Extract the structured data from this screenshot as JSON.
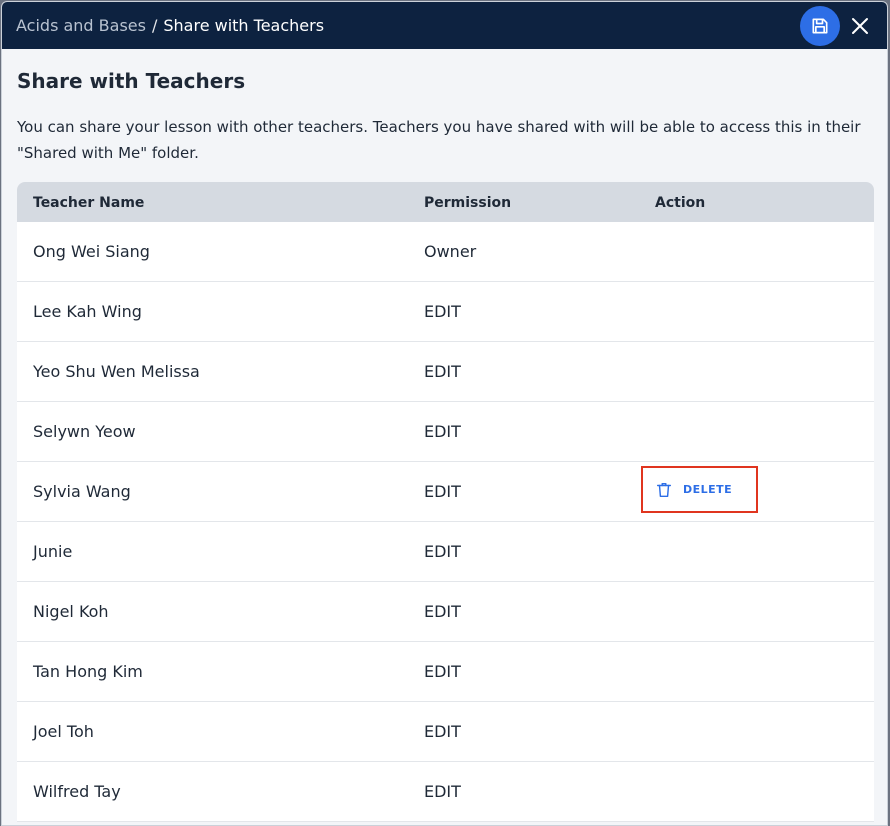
{
  "header": {
    "breadcrumb_parent": "Acids and Bases",
    "breadcrumb_separator": "/",
    "breadcrumb_current": "Share with Teachers",
    "save_icon": "save-icon",
    "close_icon": "close-icon"
  },
  "main": {
    "title": "Share with Teachers",
    "description": "You can share your lesson with other teachers. Teachers you have shared with will be able to access this in their \"Shared with Me\" folder."
  },
  "table": {
    "columns": [
      "Teacher Name",
      "Permission",
      "Action"
    ],
    "rows": [
      {
        "name": "Ong Wei Siang",
        "permission": "Owner"
      },
      {
        "name": "Lee Kah Wing",
        "permission": "EDIT"
      },
      {
        "name": "Yeo Shu Wen Melissa",
        "permission": "EDIT"
      },
      {
        "name": "Selywn Yeow",
        "permission": "EDIT"
      },
      {
        "name": "Sylvia Wang",
        "permission": "EDIT",
        "action": "DELETE"
      },
      {
        "name": "Junie",
        "permission": "EDIT"
      },
      {
        "name": "Nigel Koh",
        "permission": "EDIT"
      },
      {
        "name": "Tan Hong Kim",
        "permission": "EDIT"
      },
      {
        "name": "Joel Toh",
        "permission": "EDIT"
      },
      {
        "name": "Wilfred Tay",
        "permission": "EDIT"
      }
    ]
  },
  "colors": {
    "titlebar": "#0d2240",
    "accent": "#2d6ee6",
    "highlight_border": "#e0351f",
    "table_header": "#d5dae1"
  }
}
